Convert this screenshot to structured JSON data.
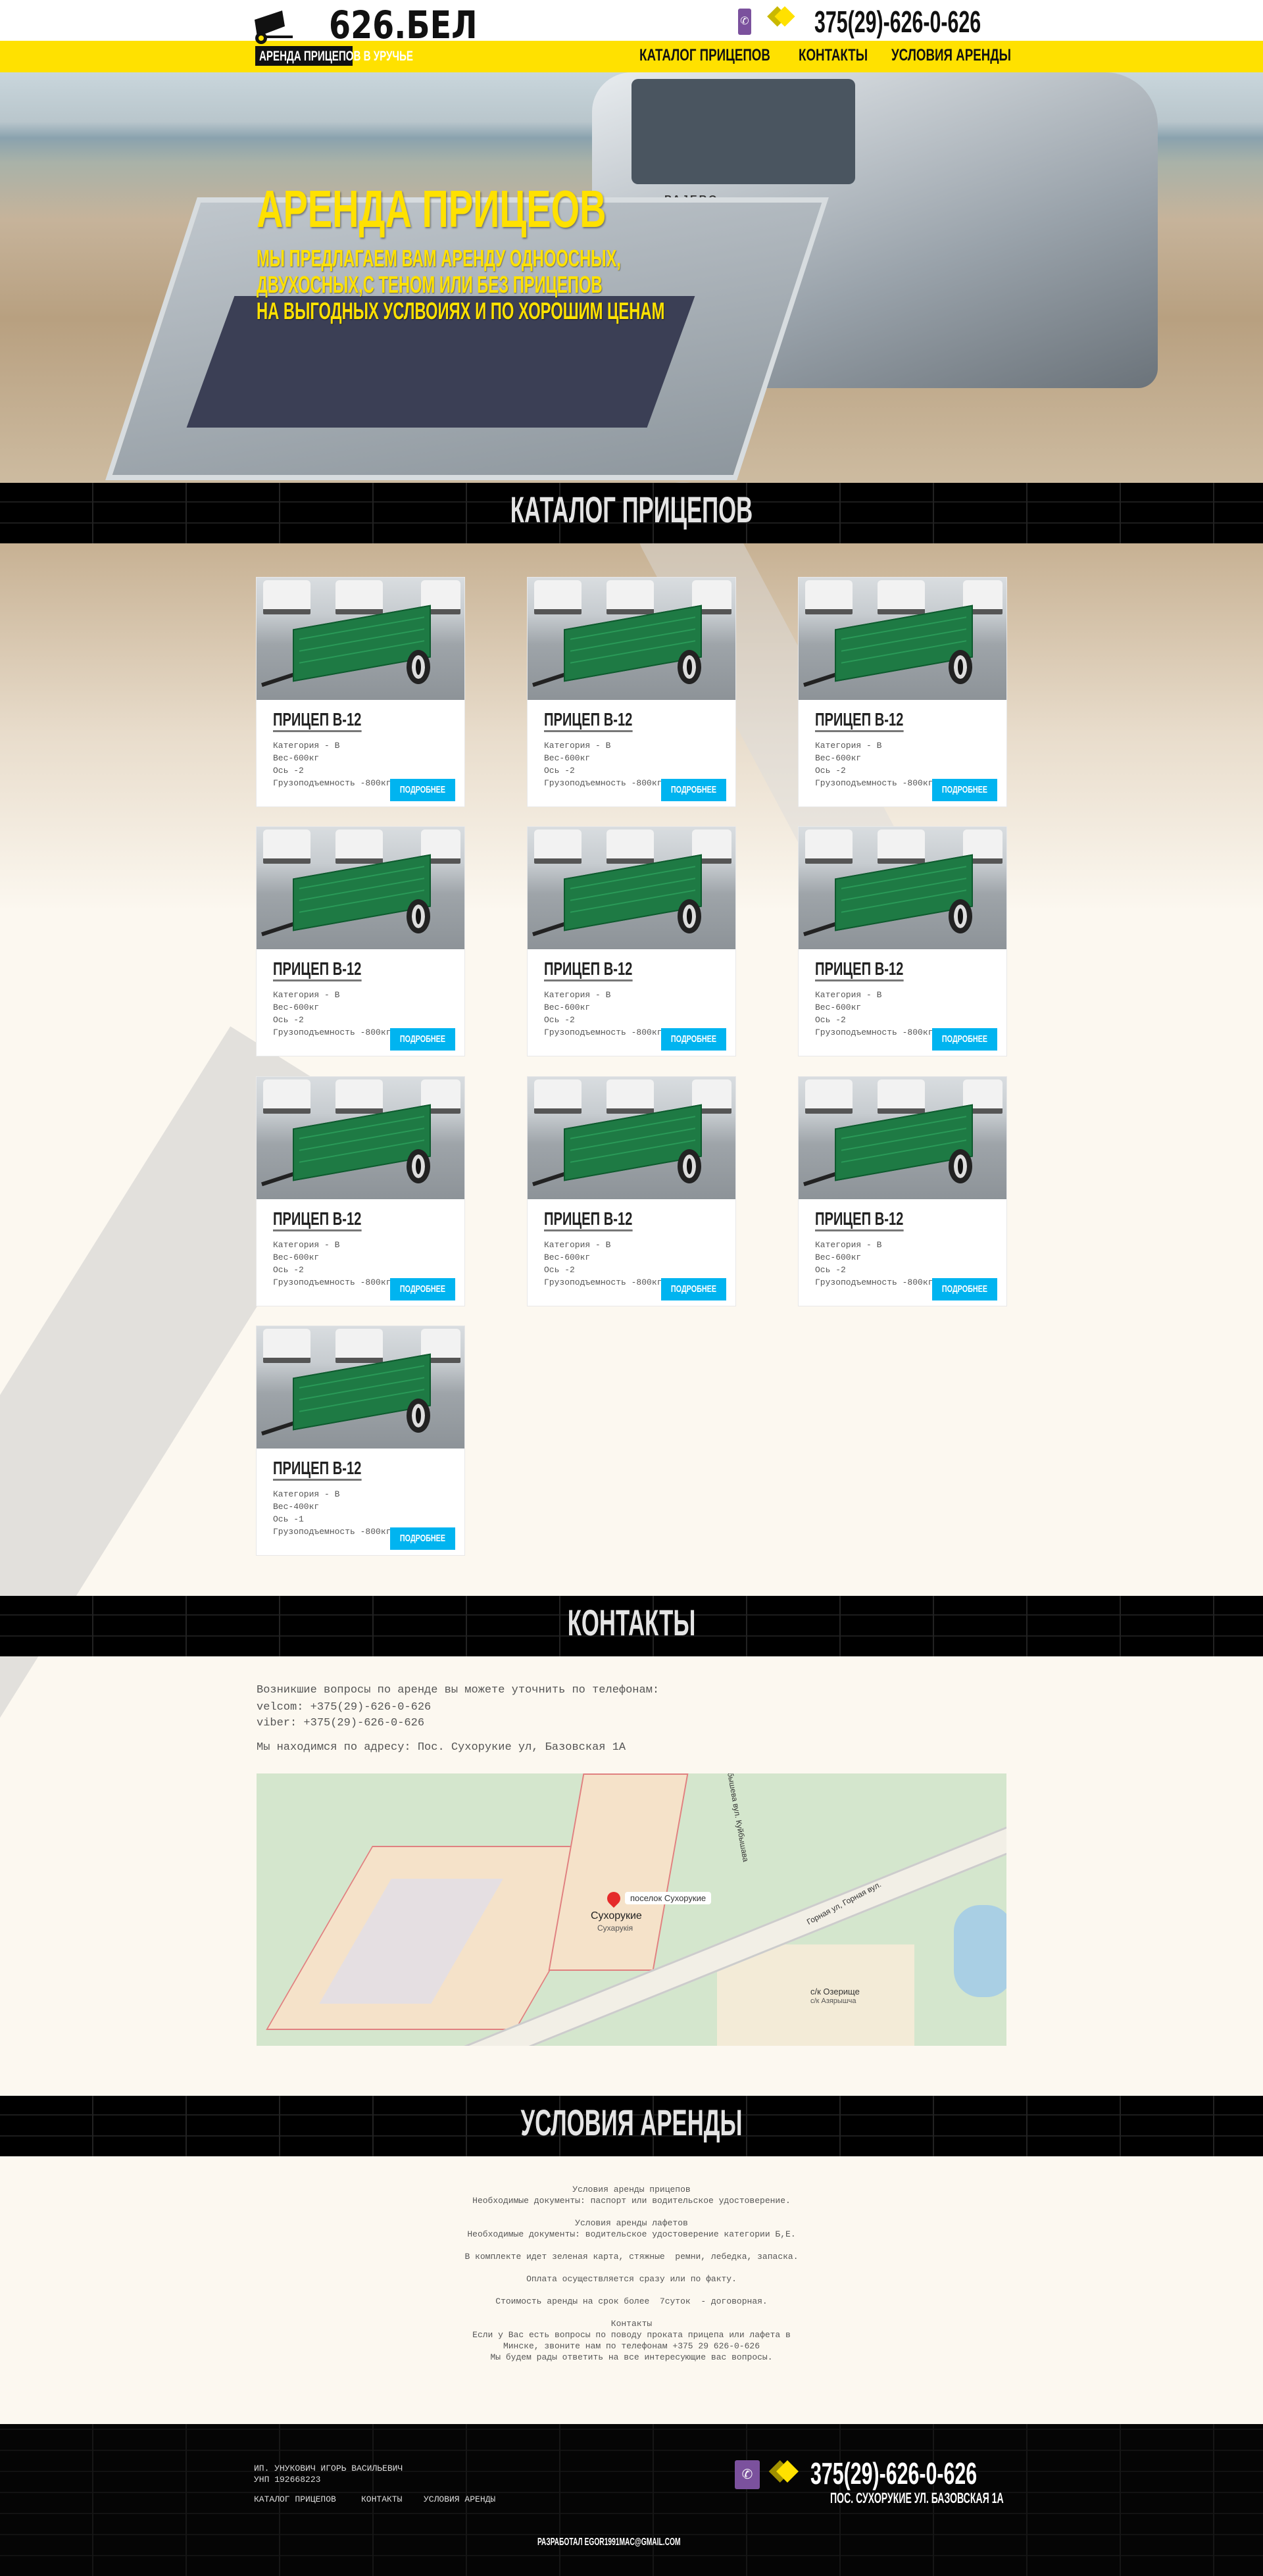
{
  "header": {
    "logo_text": "626.БЕЛ",
    "logo_subtitle": "АРЕНДА ПРИЦЕПОВ В УРУЧЬЕ",
    "phone": "375(29)-626-0-626",
    "nav": [
      "КАТАЛОГ ПРИЦЕПОВ",
      "КОНТАКТЫ",
      "УСЛОВИЯ АРЕНДЫ"
    ]
  },
  "hero": {
    "title": "АРЕНДА ПРИЦЕОВ",
    "lines": [
      "МЫ ПРЕДЛАГАЕМ ВАМ АРЕНДУ ОДНООСНЫХ,",
      "ДВУХОСНЫХ,С ТЕНОМ ИЛИ БЕЗ ПРИЦЕПОВ",
      "НА ВЫГОДНЫХ УСЛВОИЯХ И ПО ХОРОШИМ ЦЕНАМ"
    ],
    "plate_brand": "PAJERO"
  },
  "catalog": {
    "title": "КАТАЛОГ ПРИЦЕПОВ",
    "cards": [
      {
        "title": "ПРИЦЕП B-12",
        "specs": [
          "Категория - B",
          "Вес-600кг",
          "Ось -2",
          "Грузоподъемность -800кг"
        ],
        "button": "ПОДРОБНЕЕ"
      },
      {
        "title": "ПРИЦЕП B-12",
        "specs": [
          "Категория - B",
          "Вес-600кг",
          "Ось -2",
          "Грузоподъемность -800кг"
        ],
        "button": "ПОДРОБНЕЕ"
      },
      {
        "title": "ПРИЦЕП B-12",
        "specs": [
          "Категория - B",
          "Вес-600кг",
          "Ось -2",
          "Грузоподъемность -800кг"
        ],
        "button": "ПОДРОБНЕЕ"
      },
      {
        "title": "ПРИЦЕП B-12",
        "specs": [
          "Категория - B",
          "Вес-600кг",
          "Ось -2",
          "Грузоподъемность -800кг"
        ],
        "button": "ПОДРОБНЕЕ"
      },
      {
        "title": "ПРИЦЕП B-12",
        "specs": [
          "Категория - B",
          "Вес-600кг",
          "Ось -2",
          "Грузоподъемность -800кг"
        ],
        "button": "ПОДРОБНЕЕ"
      },
      {
        "title": "ПРИЦЕП B-12",
        "specs": [
          "Категория - B",
          "Вес-600кг",
          "Ось -2",
          "Грузоподъемность -800кг"
        ],
        "button": "ПОДРОБНЕЕ"
      },
      {
        "title": "ПРИЦЕП B-12",
        "specs": [
          "Категория - B",
          "Вес-600кг",
          "Ось -2",
          "Грузоподъемность -800кг"
        ],
        "button": "ПОДРОБНЕЕ"
      },
      {
        "title": "ПРИЦЕП B-12",
        "specs": [
          "Категория - B",
          "Вес-600кг",
          "Ось -2",
          "Грузоподъемность -800кг"
        ],
        "button": "ПОДРОБНЕЕ"
      },
      {
        "title": "ПРИЦЕП B-12",
        "specs": [
          "Категория - B",
          "Вес-600кг",
          "Ось -2",
          "Грузоподъемность -800кг"
        ],
        "button": "ПОДРОБНЕЕ"
      },
      {
        "title": "ПРИЦЕП B-12",
        "specs": [
          "Категория - B",
          "Вес-400кг",
          "Ось -1",
          "Грузоподъемность -800кг"
        ],
        "button": "ПОДРОБНЕЕ"
      }
    ]
  },
  "contacts": {
    "title": "КОНТАКТЫ",
    "intro": "Возникшие вопросы по аренде вы можете уточнить по телефонам:",
    "velcom": "velcom: +375(29)-626-0-626",
    "viber": "viber: +375(29)-626-0-626",
    "address": "Мы находимся по адресу: Пос. Сухорукие ул, Базовская 1А",
    "map": {
      "pin_label": "поселок Сухорукие",
      "town": "Сухорукие",
      "town_be": "Сухарукія",
      "district": "с/к Озерище",
      "district_be": "с/к Азярышча",
      "street": "Горная ул, Горная вул.",
      "street2": "ул. Куйбышева вул. Куйбышава"
    }
  },
  "conditions": {
    "title": "УСЛОВИЯ АРЕНДЫ",
    "lines": [
      "Условия аренды прицепов",
      "Необходимые документы: паспорт или водительское удостоверение.",
      "",
      "Условия аренды лафетов",
      "Необходимые документы: водительское удостоверение категории Б,Е.",
      "",
      "В комплекте идет зеленая карта, стяжные  ремни, лебедка, запаска.",
      "",
      "Оплата осуществляется сразу или по факту.",
      "",
      "Стоимость аренды на срок более  7суток  - договорная.",
      "",
      "Контакты",
      "Если у Вас есть вопросы по поводу проката прицепа или лафета в",
      "Минске, звоните нам по телефонам +375 29 626-0-626",
      "Мы будем рады ответить на все интересующие вас вопросы."
    ]
  },
  "footer": {
    "owner": "ИП. УНУКОВИЧ ИГОРЬ ВАСИЛЬЕВИЧ",
    "unp": "УНП 192668223",
    "nav": [
      "КАТАЛОГ ПРИЦЕПОВ",
      "КОНТАКТЫ",
      "УСЛОВИЯ АРЕНДЫ"
    ],
    "phone": "375(29)-626-0-626",
    "address": "ПОС. СУХОРУКИЕ УЛ. БАЗОВСКАЯ 1А",
    "developer": "РАЗРАБОТАЛ EGOR1991MAC@GMAIL.COM"
  },
  "colors": {
    "accent_yellow": "#ffe100",
    "button_blue": "#00b4f0",
    "viber_purple": "#7b519d"
  }
}
